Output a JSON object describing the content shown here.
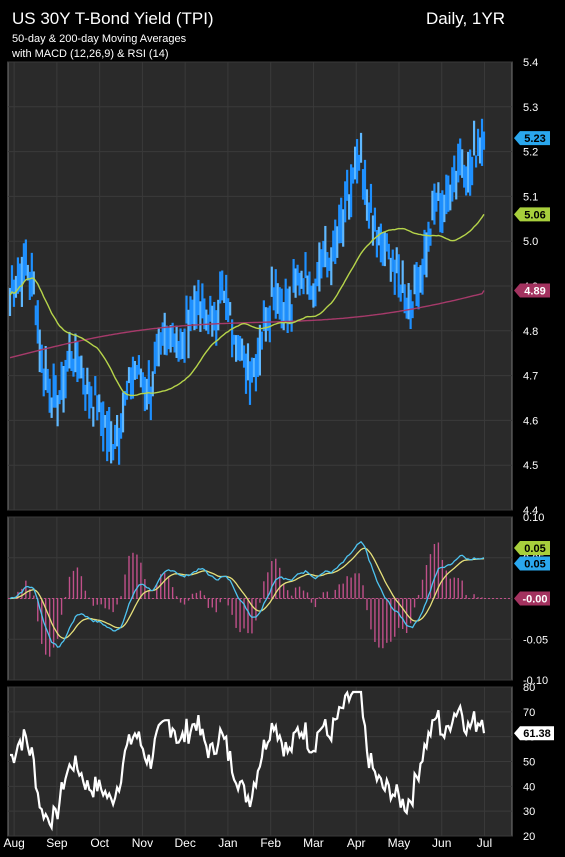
{
  "header": {
    "title": "US 30Y T-Bond Yield (TPI)",
    "period": "Daily, 1YR",
    "subtitle_line1": "50-day & 200-day Moving Averages",
    "subtitle_line2": "with MACD (12,26,9) & RSI (14)"
  },
  "colors": {
    "background": "#000000",
    "panel": "#2a2a2a",
    "grid": "#3a3a3a",
    "price": "#1e90ff",
    "price_light": "#5fb8ff",
    "ma50": "#b6d44a",
    "ma200": "#a63a6a",
    "macd": "#4ec3f0",
    "signal": "#e6e07a",
    "histogram": "#c0508a",
    "rsi": "#ffffff"
  },
  "x_axis": {
    "months": [
      "Aug",
      "Sep",
      "Oct",
      "Nov",
      "Dec",
      "Jan",
      "Feb",
      "Mar",
      "Apr",
      "May",
      "Jun",
      "Jul"
    ]
  },
  "chart_data": [
    {
      "type": "line",
      "panel": "price",
      "ylim": [
        4.4,
        5.4
      ],
      "yticks": [
        "4.4",
        "4.5",
        "4.6",
        "4.7",
        "4.8",
        "4.9",
        "5.0",
        "5.1",
        "5.2",
        "5.3",
        "5.4"
      ],
      "grid": true,
      "series": [
        {
          "name": "TPI",
          "values": [
            4.88,
            4.92,
            4.95,
            4.91,
            4.74,
            4.68,
            4.63,
            4.7,
            4.75,
            4.72,
            4.66,
            4.64,
            4.6,
            4.55,
            4.58,
            4.66,
            4.72,
            4.7,
            4.66,
            4.74,
            4.78,
            4.8,
            4.76,
            4.82,
            4.86,
            4.84,
            4.82,
            4.88,
            4.85,
            4.8,
            4.74,
            4.7,
            4.76,
            4.83,
            4.9,
            4.86,
            4.84,
            4.91,
            4.93,
            4.9,
            4.96,
            4.95,
            5.0,
            5.05,
            5.12,
            5.18,
            5.08,
            5.02,
            4.98,
            4.96,
            4.92,
            4.86,
            4.88,
            4.95,
            5.02,
            5.1,
            5.06,
            5.14,
            5.18,
            5.15,
            5.2,
            5.23
          ],
          "last_value": "5.23"
        },
        {
          "name": "50-day MA",
          "last_value": "5.06"
        },
        {
          "name": "200-day MA",
          "last_value": "4.89"
        }
      ]
    },
    {
      "type": "line",
      "panel": "macd",
      "ylim": [
        -0.1,
        0.1
      ],
      "yticks": [
        "0.10",
        "0.05",
        "-0.00",
        "-0.05",
        "-0.10"
      ],
      "series": [
        {
          "name": "MACD",
          "last_value": "0.05"
        },
        {
          "name": "Signal",
          "last_value": "0.05"
        },
        {
          "name": "Histogram",
          "last_value": "-0.00"
        }
      ]
    },
    {
      "type": "line",
      "panel": "rsi",
      "ylim": [
        20,
        80
      ],
      "yticks": [
        "20",
        "30",
        "40",
        "50",
        "60",
        "70",
        "80"
      ],
      "series": [
        {
          "name": "RSI",
          "last_value": "61.38"
        }
      ]
    }
  ]
}
